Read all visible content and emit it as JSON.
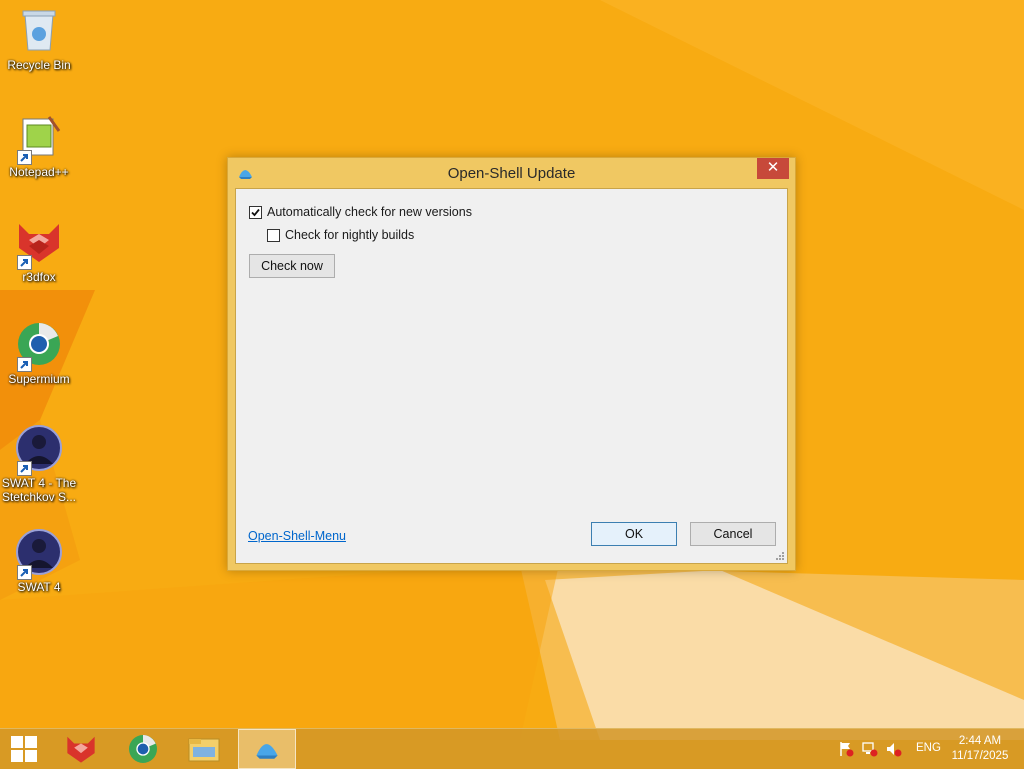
{
  "desktop": {
    "icons": [
      {
        "label": "Recycle Bin",
        "icon": "recycle-bin-icon"
      },
      {
        "label": "Notepad++",
        "icon": "notepad-plus-plus-icon"
      },
      {
        "label": "r3dfox",
        "icon": "r3dfox-icon"
      },
      {
        "label": "Supermium",
        "icon": "supermium-icon"
      },
      {
        "label": "SWAT 4 - The Stetchkov S...",
        "icon": "swat4-stetchkov-icon"
      },
      {
        "label": "SWAT 4",
        "icon": "swat4-icon"
      }
    ]
  },
  "dialog": {
    "title": "Open-Shell Update",
    "close_glyph": "✕",
    "auto_check": {
      "label": "Automatically check for new versions",
      "checked": true
    },
    "nightly": {
      "label": "Check for nightly builds",
      "checked": false
    },
    "check_now_label": "Check now",
    "link_label": "Open-Shell-Menu",
    "ok_label": "OK",
    "cancel_label": "Cancel"
  },
  "taskbar": {
    "pinned": [
      "start-icon",
      "r3dfox-icon",
      "supermium-icon",
      "file-explorer-icon",
      "open-shell-icon"
    ],
    "active": "open-shell-icon",
    "language": "ENG",
    "time": "2:44 AM",
    "date": "11/17/2025"
  },
  "colors": {
    "wallpaper": "#f7a80f",
    "dialog_frame": "#f0c862",
    "close_button": "#c7493a",
    "link": "#0066cc"
  }
}
